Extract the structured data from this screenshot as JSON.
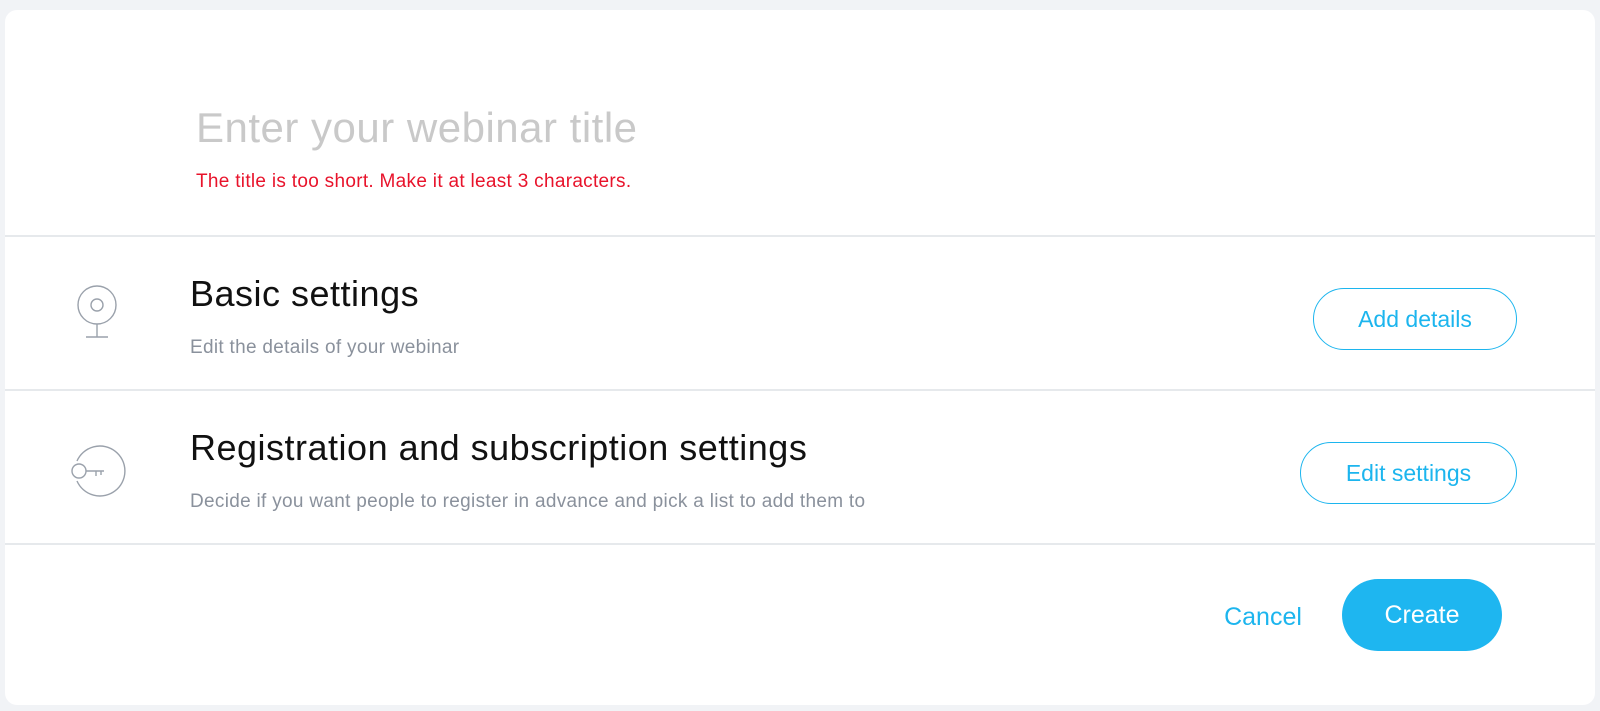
{
  "title_field": {
    "value": "",
    "placeholder": "Enter your webinar title",
    "error": "The title is too short. Make it at least 3 characters."
  },
  "sections": {
    "basic": {
      "icon": "webcam-icon",
      "heading": "Basic settings",
      "description": "Edit the details of your webinar",
      "button_label": "Add details"
    },
    "registration": {
      "icon": "key-icon",
      "heading": "Registration and subscription settings",
      "description": "Decide if you want people to register in advance and pick a list to add them to",
      "button_label": "Edit settings"
    }
  },
  "footer": {
    "cancel_label": "Cancel",
    "create_label": "Create"
  },
  "colors": {
    "accent": "#1eb6f0",
    "error": "#e8132b",
    "muted_text": "#8a919c",
    "divider": "#e6e9ec",
    "page_background": "#f1f3f6"
  }
}
